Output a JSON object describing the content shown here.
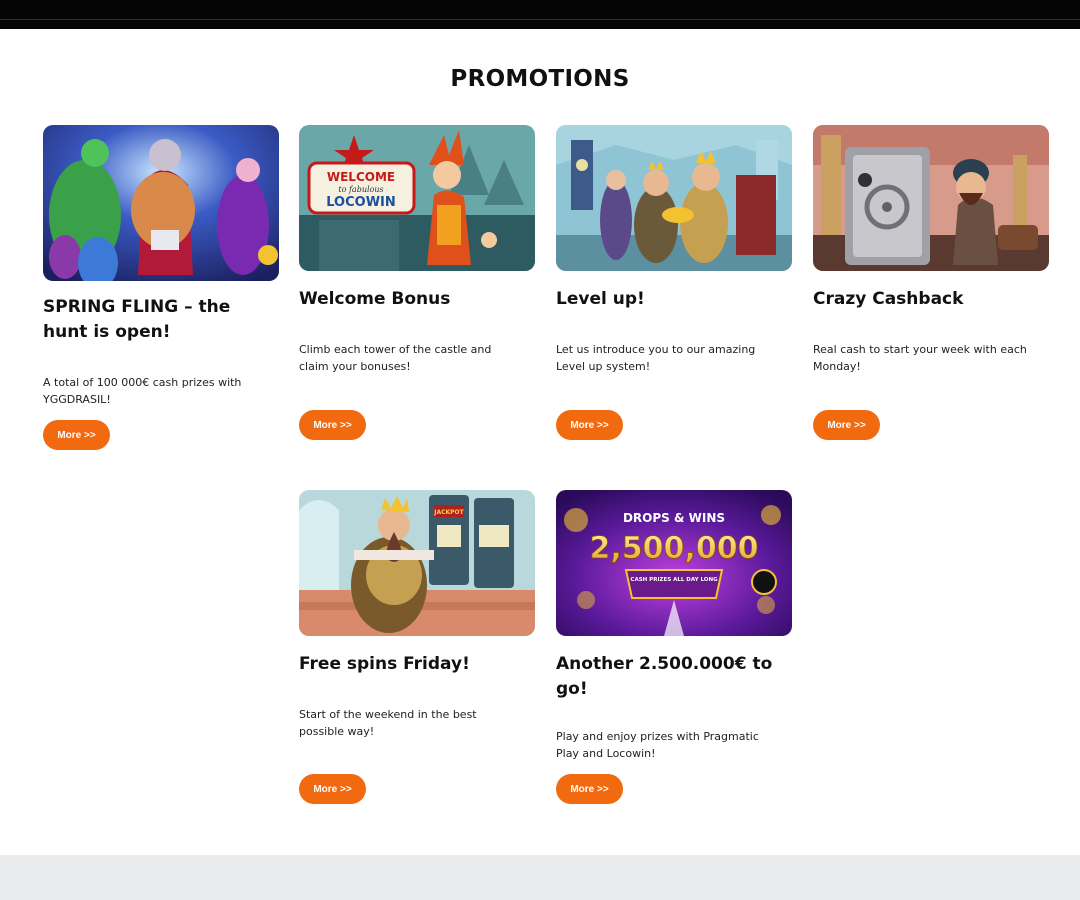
{
  "page": {
    "title": "PROMOTIONS"
  },
  "colors": {
    "accent": "#f26a10",
    "topbar": "#050505",
    "footer": "#e9ebec"
  },
  "promotions": [
    {
      "title": "SPRING FLING – the hunt is open!",
      "description": "A total of 100 000€ cash prizes with YGGDRASIL!",
      "button": "More >>",
      "image": "spring-fling-wrestlers-image"
    },
    {
      "title": "Welcome Bonus",
      "description": "Climb each tower of the castle and claim your bonuses!",
      "button": "More >>",
      "image": "welcome-locowin-jester-image",
      "sign_line1": "WELCOME",
      "sign_line2": "to fabulous",
      "sign_line3": "LOCOWIN"
    },
    {
      "title": "Level up!",
      "description": "Let us introduce you to our amazing Level up system!",
      "button": "More >>",
      "image": "level-up-kings-image"
    },
    {
      "title": "Crazy Cashback",
      "description": "Real cash to start your week with each Monday!",
      "button": "More >>",
      "image": "crazy-cashback-safe-image"
    },
    {
      "title": "Free spins Friday!",
      "description": "Start of the weekend in the best possible way!",
      "button": "More >>",
      "image": "free-spins-king-slots-image",
      "slot_label": "JACKPOT"
    },
    {
      "title": "Another 2.500.000€ to go!",
      "description": "Play and enjoy prizes with Pragmatic Play and Locowin!",
      "button": "More >>",
      "image": "drops-and-wins-image",
      "banner_top": "DROPS & WINS",
      "banner_amount": "2,500,000",
      "banner_sub": "CASH PRIZES ALL DAY LONG"
    }
  ]
}
